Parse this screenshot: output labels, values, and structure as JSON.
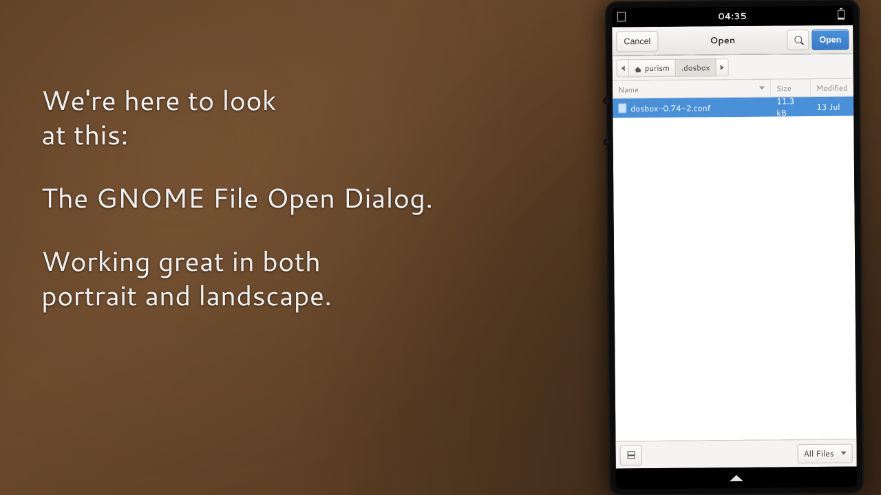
{
  "caption": {
    "line1": "We're here to look",
    "line2": "at this:",
    "line3": "The GNOME File Open Dialog.",
    "line4": "Working great in both",
    "line5": "portrait and landscape."
  },
  "statusbar": {
    "time": "04:35"
  },
  "headerbar": {
    "cancel": "Cancel",
    "title": "Open",
    "open": "Open"
  },
  "path": {
    "home_label": "purism",
    "folder": ".dosbox"
  },
  "columns": {
    "name": "Name",
    "size": "Size",
    "modified": "Modified"
  },
  "files": [
    {
      "name": "dosbox-0.74-2.conf",
      "size": "11.3 kB",
      "modified": "13 Jul",
      "selected": true
    }
  ],
  "footer": {
    "filter": "All Files"
  }
}
